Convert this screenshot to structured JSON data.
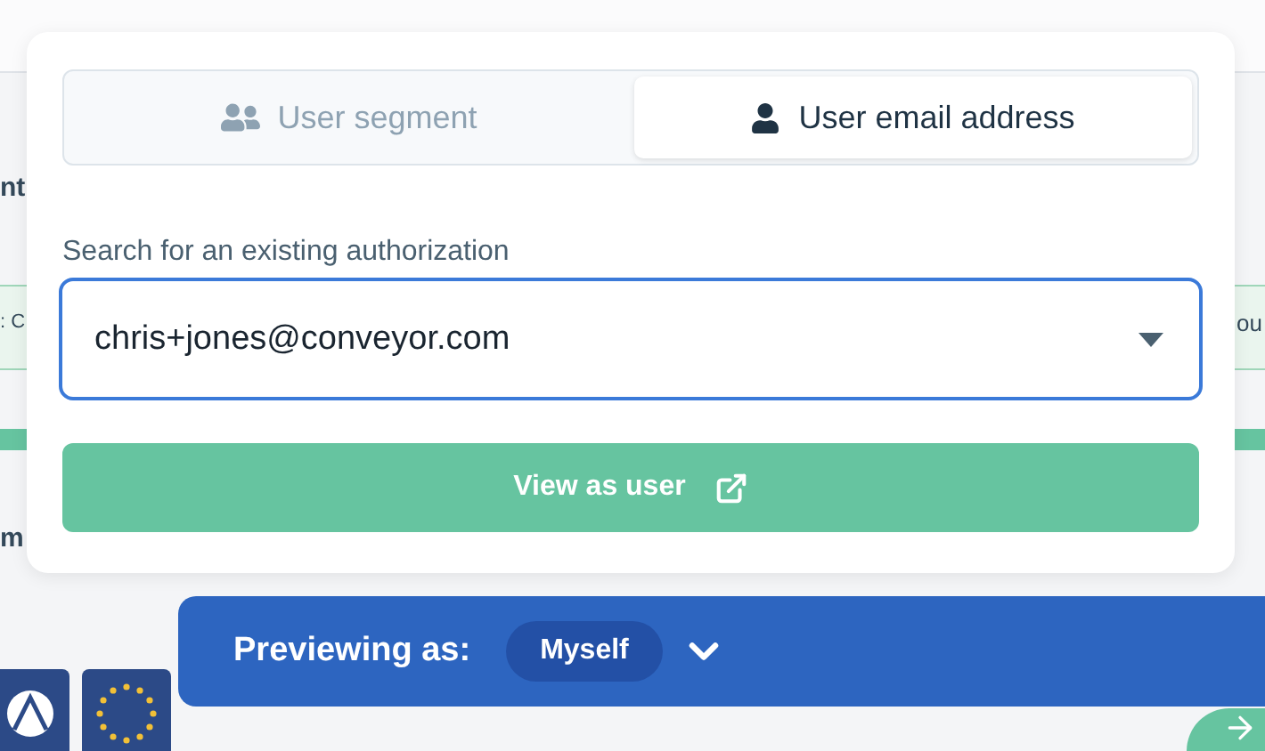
{
  "background": {
    "heading_fragment": "nt",
    "banner_left_fragment": ": C",
    "banner_right_fragment": "ou",
    "progress": {
      "level": 1
    },
    "lower_fragment": "m"
  },
  "popup": {
    "tabs": [
      {
        "label": "User segment",
        "selected": false
      },
      {
        "label": "User email address",
        "selected": true
      }
    ],
    "search": {
      "label": "Search for an existing authorization",
      "value": "chris+jones@conveyor.com"
    },
    "button": {
      "label": "View as user"
    }
  },
  "preview_bar": {
    "label": "Previewing as:",
    "value": "Myself"
  }
}
